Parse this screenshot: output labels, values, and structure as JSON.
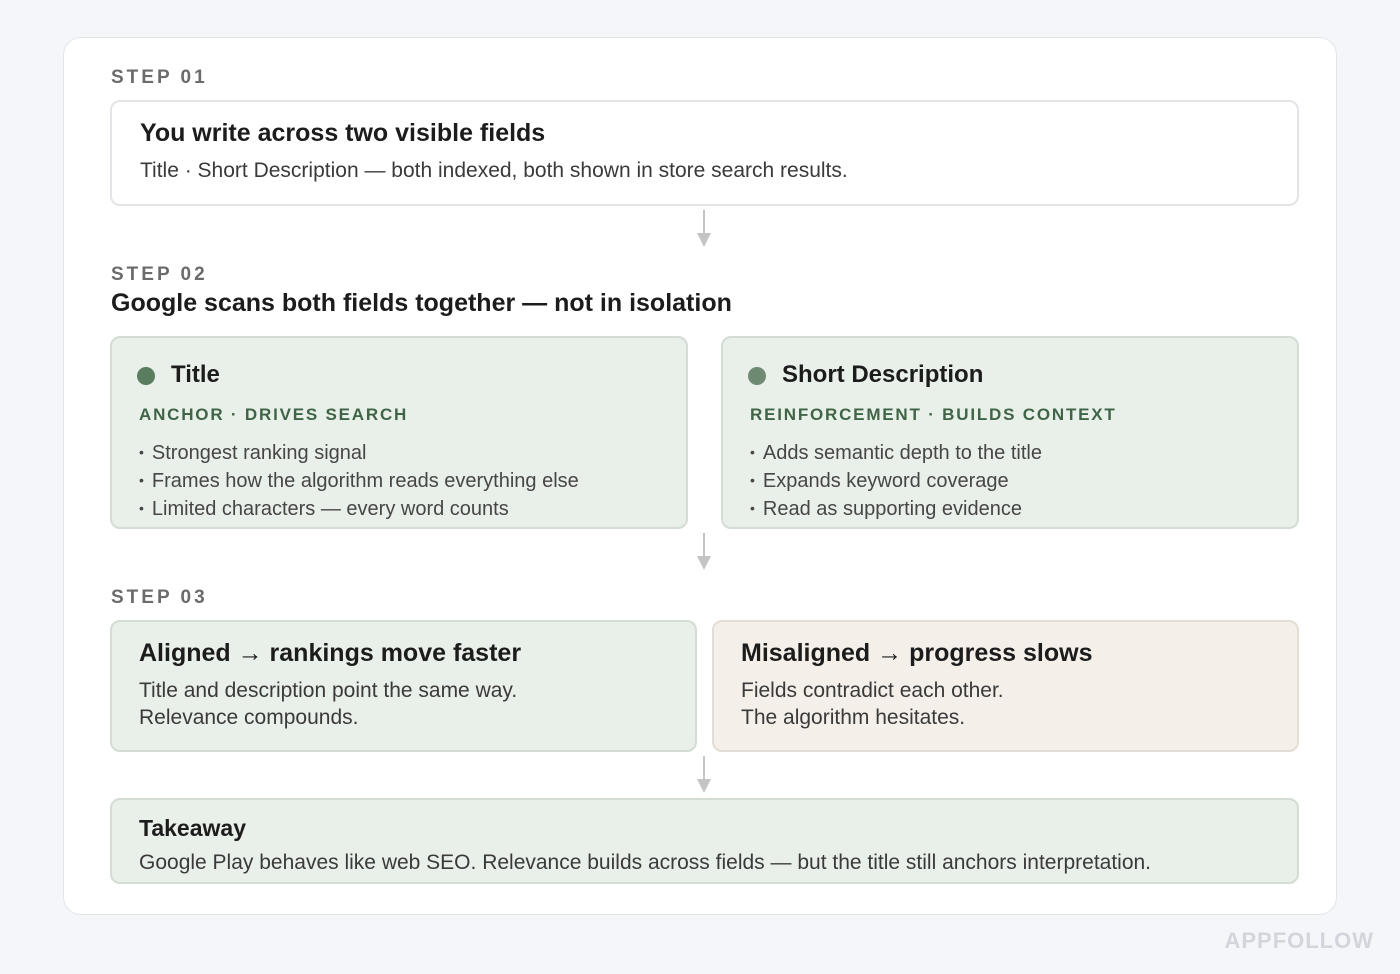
{
  "step1": {
    "label": "STEP 01",
    "title": "You write across two visible fields",
    "text": "Title · Short Description — both indexed, both shown in store search results."
  },
  "step2": {
    "label": "STEP 02",
    "heading": "Google scans both fields together — not in isolation",
    "left": {
      "title": "Title",
      "subtitle": "ANCHOR · DRIVES SEARCH",
      "dot_color": "#5a7d5f",
      "bullets": [
        "Strongest ranking signal",
        "Frames how the algorithm reads everything else",
        "Limited characters — every word counts"
      ]
    },
    "right": {
      "title": "Short Description",
      "subtitle": "REINFORCEMENT · BUILDS CONTEXT",
      "dot_color": "#6e8a73",
      "bullets": [
        "Adds semantic depth to the title",
        "Expands keyword coverage",
        "Read as supporting evidence"
      ]
    }
  },
  "step3": {
    "label": "STEP 03",
    "aligned": {
      "title": "Aligned → rankings move faster",
      "line1": "Title and description point the same way.",
      "line2": "Relevance compounds."
    },
    "misaligned": {
      "title": "Misaligned → progress slows",
      "line1": "Fields contradict each other.",
      "line2": "The algorithm hesitates."
    }
  },
  "takeaway": {
    "title": "Takeaway",
    "text": "Google Play behaves like web SEO. Relevance builds across fields — but the title still anchors interpretation."
  },
  "watermark": "APPFOLLOW",
  "colors": {
    "green_fill": "#e9efe9",
    "beige_fill": "#f4efe9",
    "accent_green": "#3f6546",
    "arrow": "#c4c4c4"
  }
}
